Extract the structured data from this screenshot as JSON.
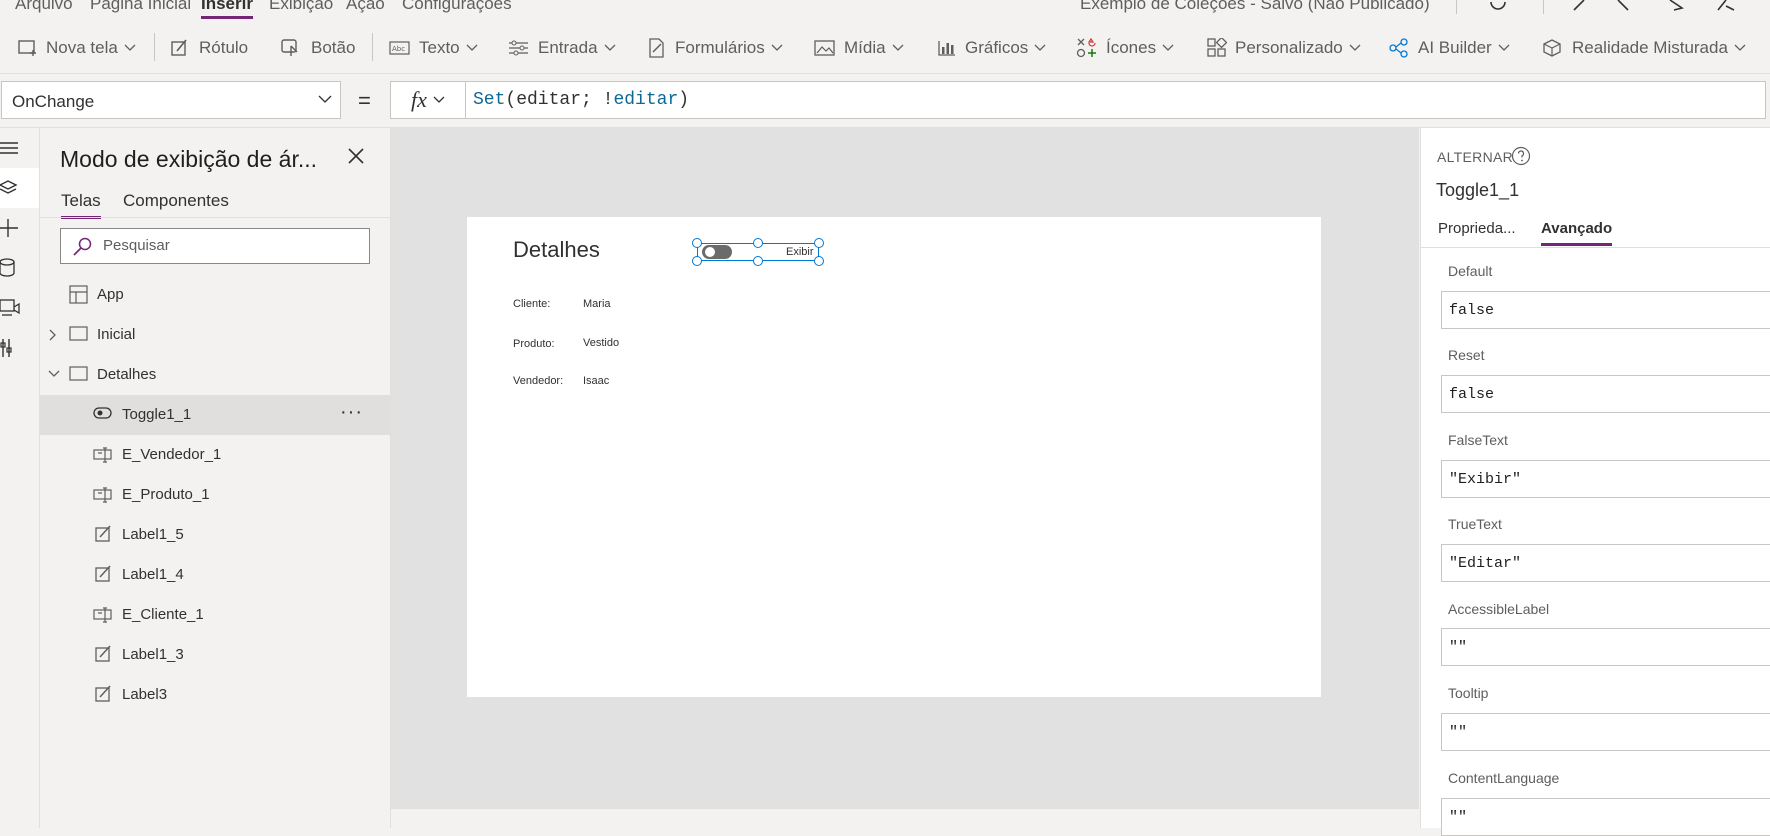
{
  "menu": {
    "items": [
      "Arquivo",
      "Página Inicial",
      "Inserir",
      "Exibição",
      "Ação",
      "Configurações"
    ],
    "active": "Inserir",
    "doc_title": "Exemplo de Coleções - Salvo (Não Publicado)"
  },
  "toolbar": {
    "nova_tela": "Nova tela",
    "rotulo": "Rótulo",
    "botao": "Botão",
    "texto": "Texto",
    "entrada": "Entrada",
    "formularios": "Formulários",
    "midia": "Mídia",
    "graficos": "Gráficos",
    "icones": "Ícones",
    "personalizado": "Personalizado",
    "ai_builder": "AI Builder",
    "realidade_misturada": "Realidade Misturada"
  },
  "formula_bar": {
    "property": "OnChange",
    "equals": "=",
    "fx": "fx",
    "formula_fn": "Set",
    "formula_args_open": "(editar; !",
    "formula_ref": "editar",
    "formula_close": ")"
  },
  "tree": {
    "title": "Modo de exibição de ár...",
    "tabs": [
      "Telas",
      "Componentes"
    ],
    "search_placeholder": "Pesquisar",
    "items": [
      {
        "label": "App",
        "icon": "app-icon"
      },
      {
        "label": "Inicial",
        "icon": "screen-icon"
      },
      {
        "label": "Detalhes",
        "icon": "screen-icon"
      },
      {
        "label": "Toggle1_1",
        "icon": "toggle-icon"
      },
      {
        "label": "E_Vendedor_1",
        "icon": "text-input-icon"
      },
      {
        "label": "E_Produto_1",
        "icon": "text-input-icon"
      },
      {
        "label": "Label1_5",
        "icon": "label-icon"
      },
      {
        "label": "Label1_4",
        "icon": "label-icon"
      },
      {
        "label": "E_Cliente_1",
        "icon": "text-input-icon"
      },
      {
        "label": "Label1_3",
        "icon": "label-icon"
      },
      {
        "label": "Label3",
        "icon": "label-icon"
      }
    ],
    "more": "···"
  },
  "screen": {
    "title": "Detalhes",
    "fields": [
      {
        "label": "Cliente:",
        "value": "Maria"
      },
      {
        "label": "Produto:",
        "value": "Vestido"
      },
      {
        "label": "Vendedor:",
        "value": "Isaac"
      }
    ],
    "toggle_text": "Exibir"
  },
  "right_panel": {
    "control_type": "ALTERNAR",
    "control_name": "Toggle1_1",
    "tabs": [
      "Proprieda...",
      "Avançado"
    ],
    "properties": [
      {
        "name": "Default",
        "value": "false"
      },
      {
        "name": "Reset",
        "value": "false"
      },
      {
        "name": "FalseText",
        "value": "\"Exibir\""
      },
      {
        "name": "TrueText",
        "value": "\"Editar\""
      },
      {
        "name": "AccessibleLabel",
        "value": "\"\""
      },
      {
        "name": "Tooltip",
        "value": "\"\""
      },
      {
        "name": "ContentLanguage",
        "value": "\"\""
      }
    ]
  },
  "colors": {
    "accent": "#742774",
    "selection": "#0078d4",
    "formula_fn": "#0b6a94"
  }
}
